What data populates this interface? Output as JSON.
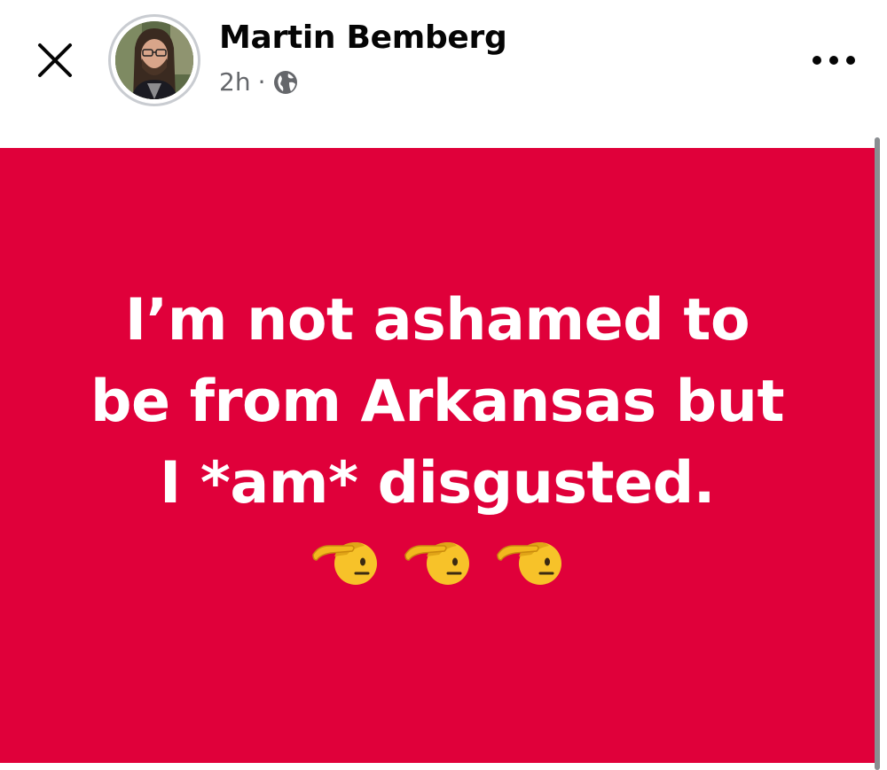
{
  "header": {
    "author_name": "Martin Bemberg",
    "timestamp": "2h",
    "separator": "·",
    "audience_icon": "globe-icon",
    "close_icon": "close-icon",
    "more_icon": "more-horizontal-icon"
  },
  "post": {
    "text": "I’m not ashamed to\nbe from Arkansas but\nI *am* disgusted.",
    "emojis": [
      "saluting-face",
      "saluting-face",
      "saluting-face"
    ],
    "background_color": "#e0003a",
    "text_color": "#ffffff"
  }
}
